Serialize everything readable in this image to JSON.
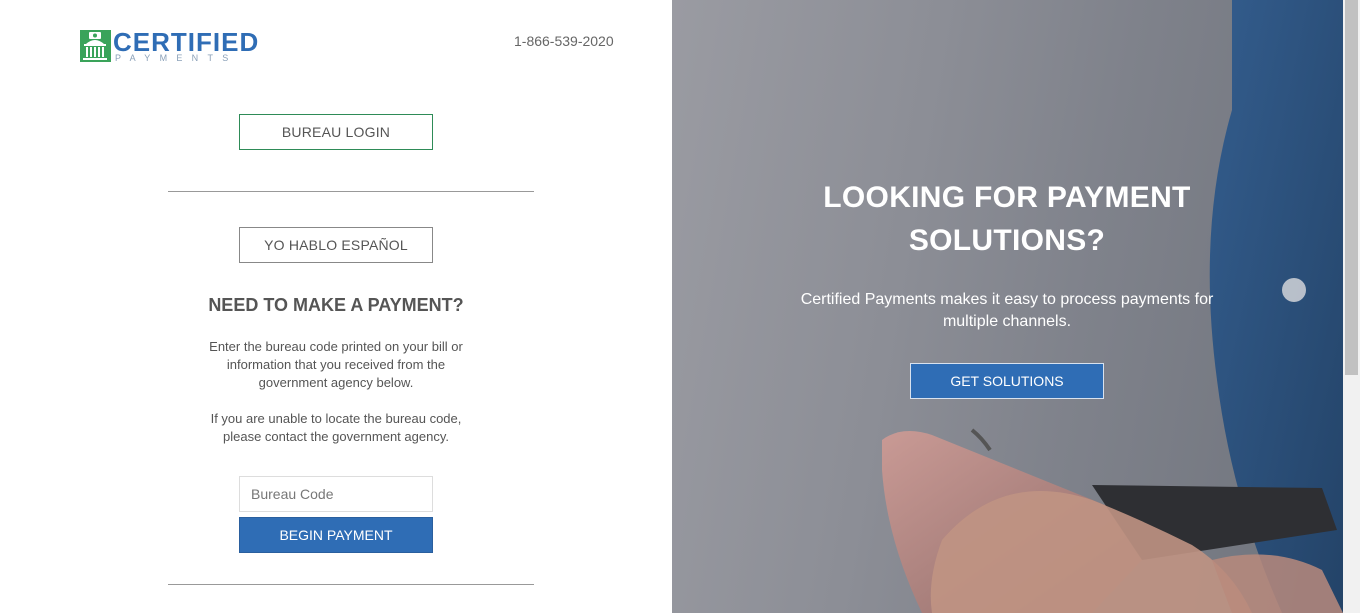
{
  "brand": {
    "name": "CERTIFIED",
    "tagline": "PAYMENTS",
    "colors": {
      "blue": "#2f6db5",
      "green": "#2e8b57"
    }
  },
  "header": {
    "phone": "1-866-539-2020"
  },
  "login": {
    "bureau_login_label": "BUREAU LOGIN",
    "spanish_label": "YO HABLO ESPAÑOL"
  },
  "payment": {
    "title": "NEED TO MAKE A PAYMENT?",
    "instructions": "Enter the bureau code printed on your bill or information that you received from the government agency below.",
    "help": "If you are unable to locate the bureau code, please contact the government agency.",
    "bureau_code_placeholder": "Bureau Code",
    "bureau_code_value": "",
    "begin_label": "BEGIN PAYMENT"
  },
  "hero": {
    "title": "LOOKING FOR PAYMENT SOLUTIONS?",
    "text": "Certified Payments makes it easy to process payments for multiple channels.",
    "cta_label": "GET SOLUTIONS"
  },
  "icons": [
    "capitol-building-icon"
  ]
}
